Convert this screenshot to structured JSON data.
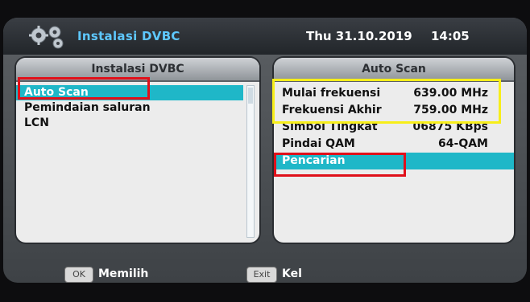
{
  "header": {
    "title": "Instalasi DVBC",
    "date": "Thu 31.10.2019",
    "time": "14:05",
    "icon": "gears-icon"
  },
  "left_panel": {
    "title": "Instalasi DVBC",
    "items": [
      {
        "label": "Auto Scan",
        "selected": true
      },
      {
        "label": "Pemindaian saluran",
        "selected": false
      },
      {
        "label": "LCN",
        "selected": false
      }
    ]
  },
  "right_panel": {
    "title": "Auto Scan",
    "rows": [
      {
        "label": "Mulai frekuensi",
        "value": "639.00 MHz"
      },
      {
        "label": "Frekuensi Akhir",
        "value": "759.00 MHz"
      },
      {
        "label": "Simbol Tingkat",
        "value": "06875 KBps"
      },
      {
        "label": "Pindai QAM",
        "value": "64-QAM"
      },
      {
        "label": "Pencarian",
        "value": ""
      }
    ]
  },
  "footer": {
    "ok_key": "OK",
    "ok_label": "Memilih",
    "exit_key": "Exit",
    "exit_label": "Kel"
  },
  "colors": {
    "selection": "#1fb7c8",
    "title_text": "#5ec8ff",
    "highlight_red": "#e0101a",
    "highlight_yellow": "#f7ee1a"
  }
}
